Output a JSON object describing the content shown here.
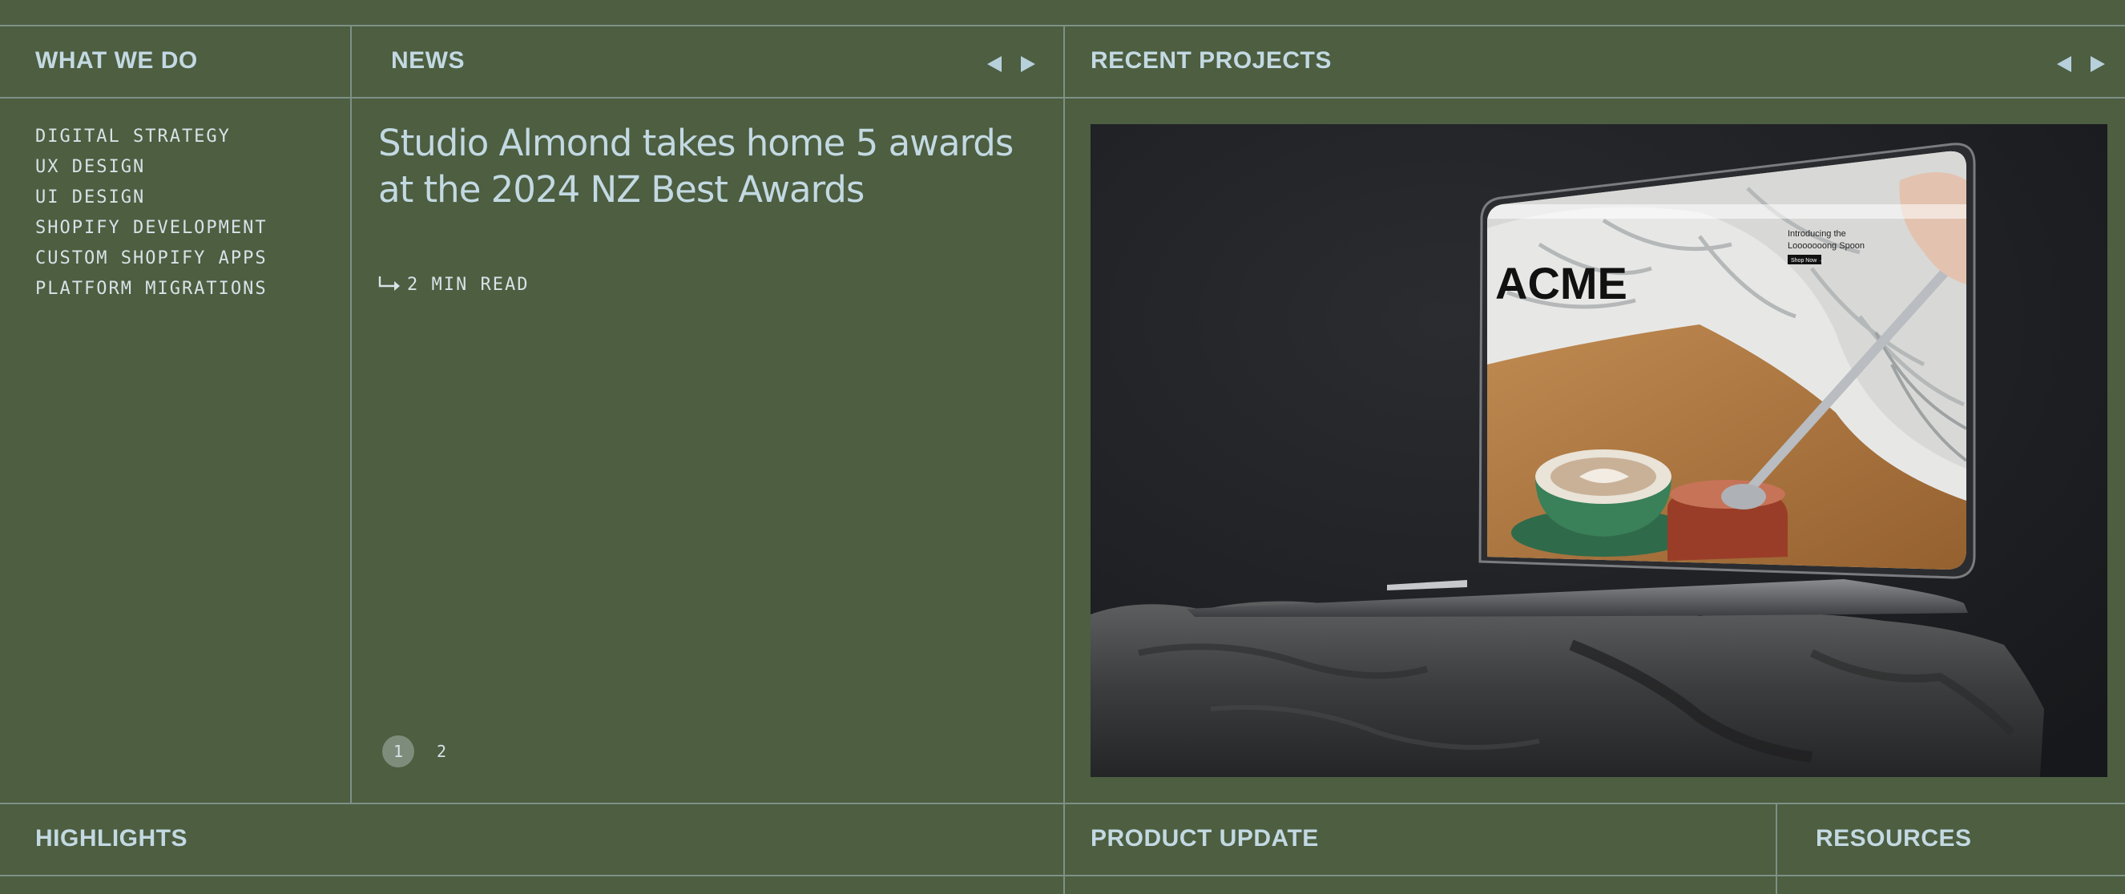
{
  "sections": {
    "what_we_do": "WHAT WE DO",
    "news": "NEWS",
    "recent_projects": "RECENT PROJECTS",
    "highlights": "HIGHLIGHTS",
    "product_update": "PRODUCT UPDATE",
    "resources": "RESOURCES"
  },
  "services": [
    "DIGITAL STRATEGY",
    "UX DESIGN",
    "UI DESIGN",
    "SHOPIFY DEVELOPMENT",
    "CUSTOM SHOPIFY APPS",
    "PLATFORM MIGRATIONS"
  ],
  "news": {
    "title_line1": "Studio Almond takes home 5 awards",
    "title_line2": "at the 2024 NZ Best Awards",
    "read_time": "2 MIN READ",
    "pages": [
      "1",
      "2"
    ],
    "active_page": 1
  },
  "project": {
    "screen_logo": "ACME",
    "screen_promo_line1": "Introducing the",
    "screen_promo_line2": "Looooooong Spoon",
    "screen_cta": "Shop Now →"
  },
  "colors": {
    "background": "#4d5e41",
    "text": "#c3d9e2",
    "rule": "#7d9186"
  }
}
